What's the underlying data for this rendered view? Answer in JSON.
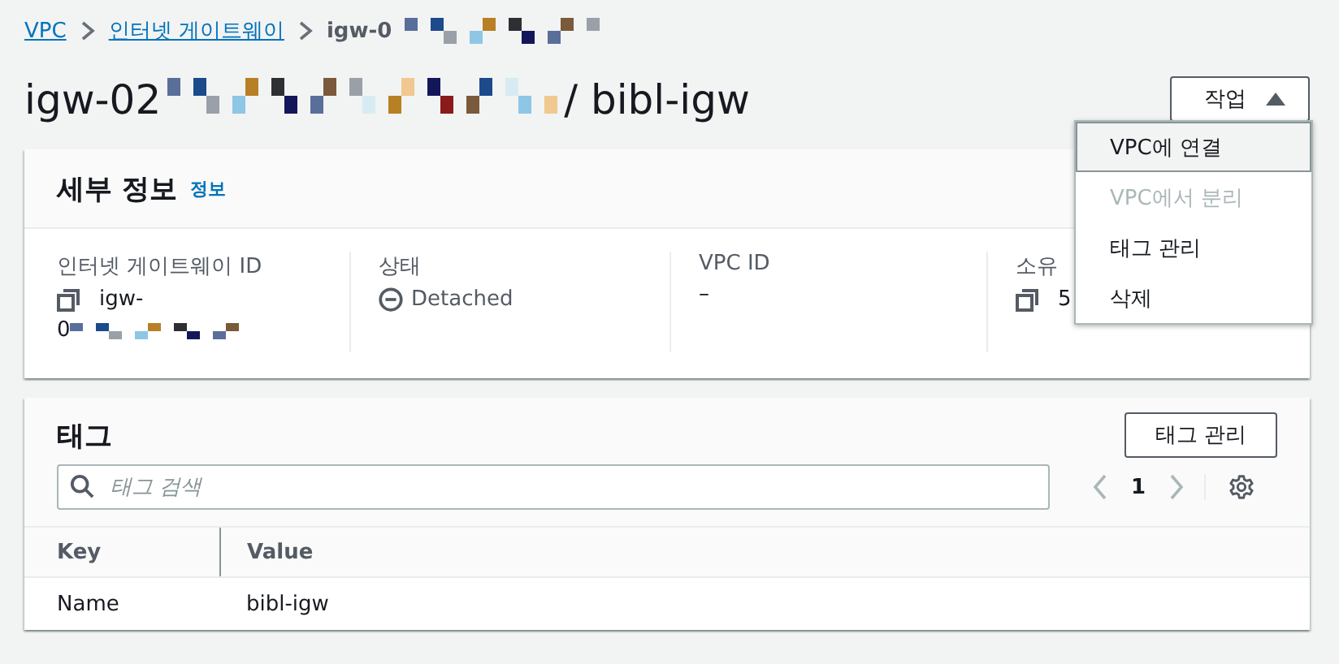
{
  "breadcrumb": [
    {
      "label": "VPC",
      "kind": "link"
    },
    {
      "label": "인터넷 게이트웨이",
      "kind": "link"
    },
    {
      "label": "igw-0",
      "kind": "current",
      "redacted": true
    }
  ],
  "title": {
    "id_prefix": "igw-02",
    "redacted": true,
    "name": "/ bibl-igw"
  },
  "actions_button": {
    "label": "작업",
    "expanded": true
  },
  "actions_menu": [
    {
      "label": "VPC에 연결",
      "disabled": false,
      "highlighted": true
    },
    {
      "label": "VPC에서 분리",
      "disabled": true,
      "highlighted": false
    },
    {
      "label": "태그 관리",
      "disabled": false,
      "highlighted": false
    },
    {
      "label": "삭제",
      "disabled": false,
      "highlighted": false
    }
  ],
  "details": {
    "title": "세부 정보",
    "info_link": "정보",
    "fields": [
      {
        "label": "인터넷 게이트웨이 ID",
        "kind": "copy",
        "value": "igw-",
        "value_line2": "0",
        "redacted": true
      },
      {
        "label": "상태",
        "kind": "status",
        "value": "Detached"
      },
      {
        "label": "VPC ID",
        "kind": "text",
        "value": "–"
      },
      {
        "label": "소유",
        "kind": "copy",
        "value": "5"
      }
    ]
  },
  "tags": {
    "title": "태그",
    "manage_button": "태그 관리",
    "search": {
      "placeholder": "태그 검색"
    },
    "page": "1",
    "columns": [
      "Key",
      "Value"
    ],
    "rows": [
      [
        "Name",
        "bibl-igw"
      ]
    ]
  }
}
